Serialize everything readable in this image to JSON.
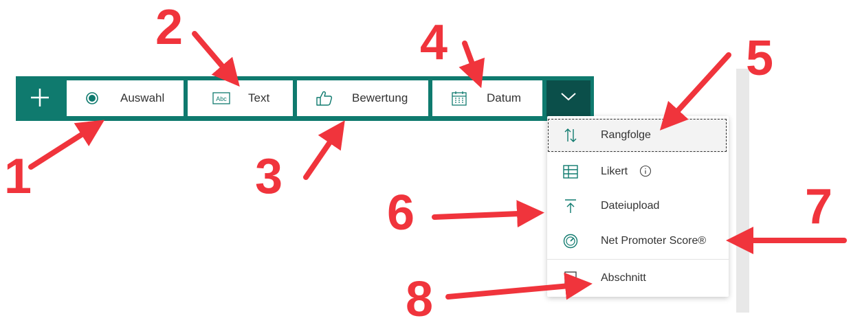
{
  "toolbar": {
    "add_icon": "plus-icon",
    "buttons": [
      {
        "label": "Auswahl",
        "icon": "radio-icon"
      },
      {
        "label": "Text",
        "icon": "text-abc-icon"
      },
      {
        "label": "Bewertung",
        "icon": "thumbs-up-icon"
      },
      {
        "label": "Datum",
        "icon": "calendar-icon"
      }
    ],
    "more_icon": "chevron-down-icon",
    "text_icon_glyph": "Abc"
  },
  "menu": {
    "items": [
      {
        "label": "Rangfolge",
        "icon": "sort-arrows-icon"
      },
      {
        "label": "Likert",
        "icon": "grid-icon"
      },
      {
        "label": "Dateiupload",
        "icon": "upload-icon"
      },
      {
        "label": "Net Promoter Score®",
        "icon": "gauge-icon"
      },
      {
        "label": "Abschnitt",
        "icon": "section-icon"
      }
    ]
  },
  "annotations": [
    "1",
    "2",
    "3",
    "4",
    "5",
    "6",
    "7",
    "8"
  ],
  "colors": {
    "toolbar_bg": "#0f7a6e",
    "more_bg": "#0b4f4a",
    "icon_teal": "#0f7a6e",
    "annotation_red": "#f0343c"
  }
}
